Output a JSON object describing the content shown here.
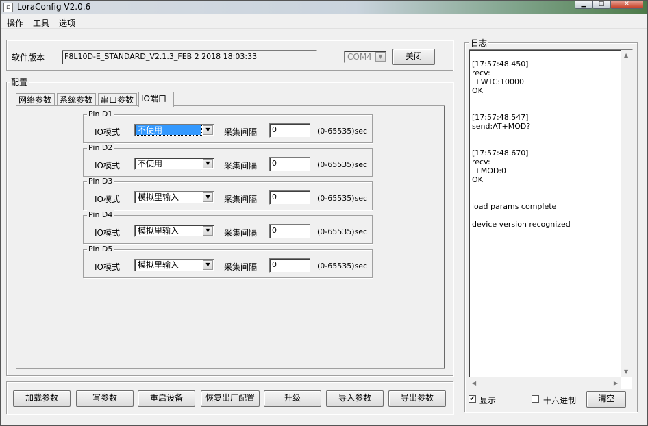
{
  "window": {
    "title": "LoraConfig V2.0.6"
  },
  "menu": [
    "操作",
    "工具",
    "选项"
  ],
  "version": {
    "label": "软件版本",
    "value": "F8L10D-E_STANDARD_V2.1.3_FEB  2 2018 18:03:33",
    "port": "COM4",
    "close_button": "关闭"
  },
  "config": {
    "group_title": "配置",
    "tabs": [
      "网络参数",
      "系统参数",
      "串口参数",
      "IO端口"
    ],
    "active_tab": 3,
    "pins": [
      {
        "title": "Pin D1",
        "mode_label": "IO模式",
        "mode": "不使用",
        "interval_label": "采集间隔",
        "interval": "0",
        "range": "(0-65535)sec"
      },
      {
        "title": "Pin D2",
        "mode_label": "IO模式",
        "mode": "不使用",
        "interval_label": "采集间隔",
        "interval": "0",
        "range": "(0-65535)sec"
      },
      {
        "title": "Pin D3",
        "mode_label": "IO模式",
        "mode": "模拟里输入",
        "interval_label": "采集间隔",
        "interval": "0",
        "range": "(0-65535)sec"
      },
      {
        "title": "Pin D4",
        "mode_label": "IO模式",
        "mode": "模拟里输入",
        "interval_label": "采集间隔",
        "interval": "0",
        "range": "(0-65535)sec"
      },
      {
        "title": "Pin D5",
        "mode_label": "IO模式",
        "mode": "模拟里输入",
        "interval_label": "采集间隔",
        "interval": "0",
        "range": "(0-65535)sec"
      }
    ]
  },
  "actions": [
    "加载参数",
    "写参数",
    "重启设备",
    "恢复出厂配置",
    "升级",
    "导入参数",
    "导出参数"
  ],
  "log": {
    "title": "日志",
    "text": "[17:57:48.450]\nrecv:\n +WTC:10000\nOK\n\n\n[17:57:48.547]\nsend:AT+MOD?\n\n\n[17:57:48.670]\nrecv:\n +MOD:0\nOK\n\n\nload params complete\n\ndevice version recognized",
    "show_label": "显示",
    "show_checked": true,
    "hex_label": "十六进制",
    "hex_checked": false,
    "clear_button": "清空"
  }
}
